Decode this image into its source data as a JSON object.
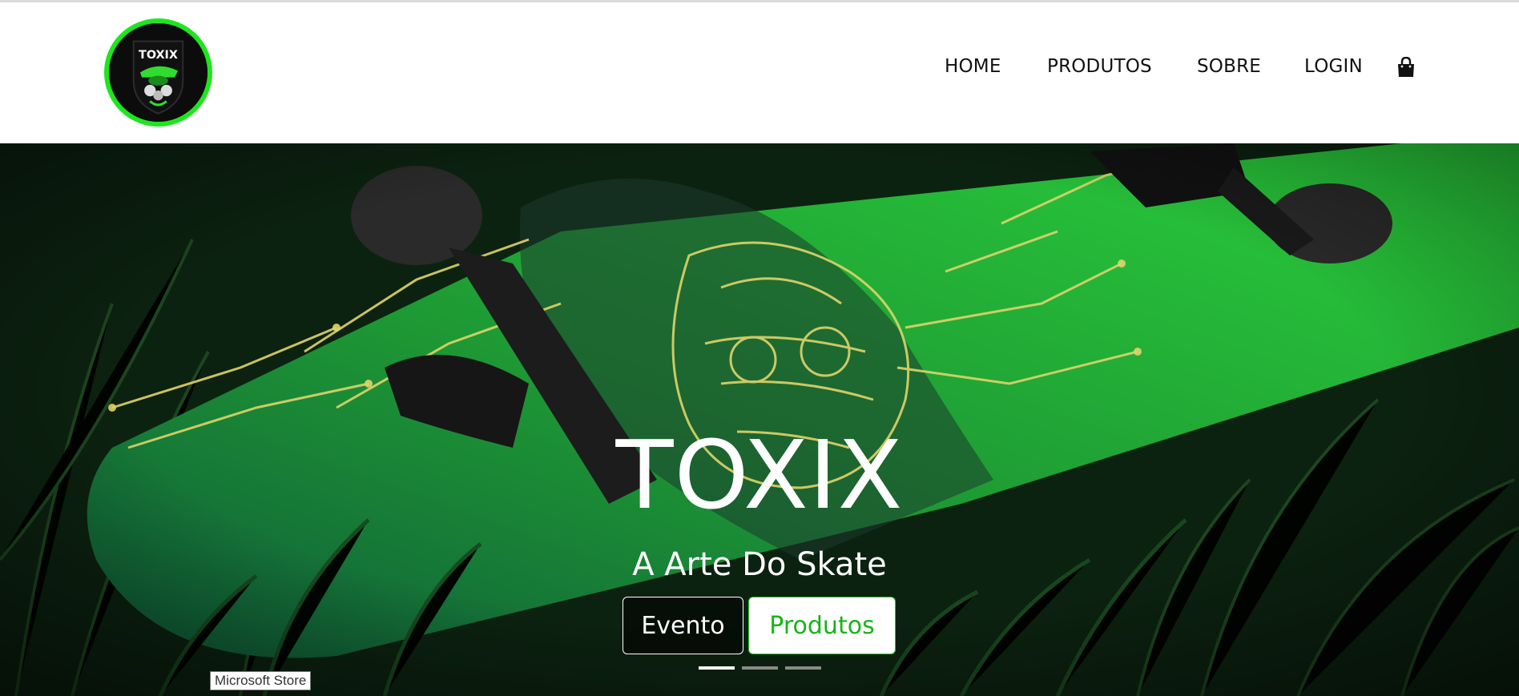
{
  "brand": {
    "logo_text": "TOXIX",
    "accent": "#1ee61e"
  },
  "nav": {
    "items": [
      {
        "label": "HOME"
      },
      {
        "label": "PRODUTOS"
      },
      {
        "label": "SOBRE"
      },
      {
        "label": "LOGIN"
      }
    ],
    "cart_icon": "shopping-bag-icon"
  },
  "hero": {
    "title": "TOXIX",
    "subtitle": "A Arte Do Skate",
    "buttons": {
      "evento": "Evento",
      "produtos": "Produtos"
    },
    "slides": {
      "count": 3,
      "active": 1
    },
    "colors": {
      "button_green": "#19b319",
      "deck_green": "#1e9a34",
      "circuit_gold": "#e0d46a"
    }
  },
  "tooltip": {
    "text": "Microsoft Store"
  }
}
